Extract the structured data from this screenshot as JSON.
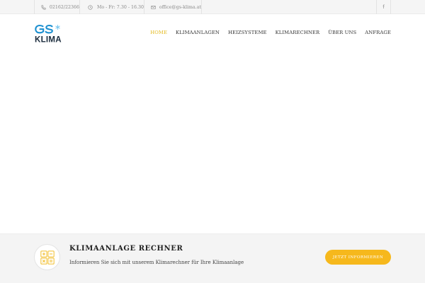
{
  "topbar": {
    "phone": {
      "icon": "phone-icon",
      "text": "02162/22366"
    },
    "hours": {
      "icon": "clock-icon",
      "text": "Mo - Fr: 7.30 - 16.30"
    },
    "email": {
      "icon": "envelope-icon",
      "text": "office@gs-klima.at"
    },
    "social": {
      "icon": "facebook-icon",
      "glyph": "f"
    }
  },
  "header": {
    "logo": {
      "letters": "GS",
      "wordmark": "KLIMA",
      "icon": "snowflake-icon"
    },
    "nav": [
      {
        "label": "HOME",
        "active": true
      },
      {
        "label": "KLIMAANLAGEN",
        "active": false
      },
      {
        "label": "HEIZSYSTEME",
        "active": false
      },
      {
        "label": "KLIMARECHNER",
        "active": false
      },
      {
        "label": "ÜBER UNS",
        "active": false
      },
      {
        "label": "ANFRAGE",
        "active": false
      }
    ]
  },
  "calculator": {
    "icon": "calculator-icon",
    "title": "KLIMAANLAGE RECHNER",
    "text": "Informieren Sie sich mit unserem Klimarechner für Ihre Klimaanlage",
    "button": "JETZT INFORMIEREN"
  },
  "colors": {
    "accent": "#f6b81c",
    "nav_active": "#e3b91c",
    "logo_blue": "#1b8fd0",
    "topbar_bg": "#f5f5f5",
    "band_bg": "#f4f4f4"
  }
}
